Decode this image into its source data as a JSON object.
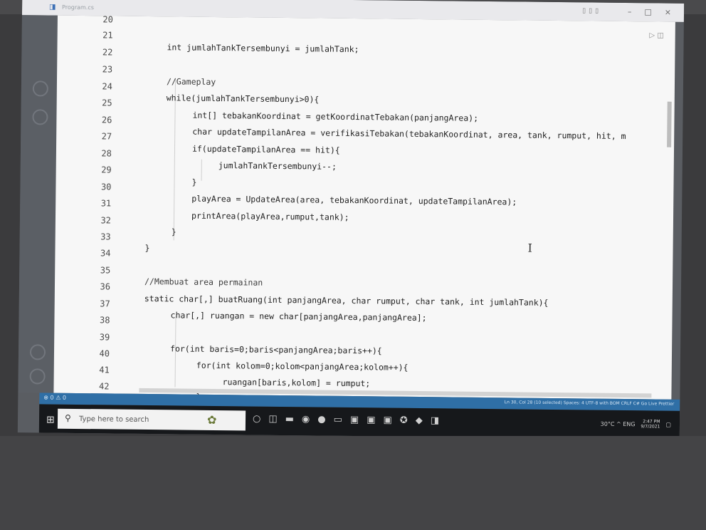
{
  "window": {
    "title": "Program.cs",
    "controls": [
      "–",
      "□",
      "×"
    ],
    "layout_icons": [
      "▯",
      "▯",
      "▯"
    ]
  },
  "editor": {
    "toolbar_icons": "▷ ◫",
    "lines": [
      {
        "n": "20",
        "code": ""
      },
      {
        "n": "21",
        "code": ""
      },
      {
        "n": "22",
        "code": "int jumlahTankTersembunyi = jumlahTank;"
      },
      {
        "n": "23",
        "code": ""
      },
      {
        "n": "24",
        "code": "//Gameplay"
      },
      {
        "n": "25",
        "code": "while(jumlahTankTersembunyi>0){"
      },
      {
        "n": "26",
        "code": "int[] tebakanKoordinat = getKoordinatTebakan(panjangArea);"
      },
      {
        "n": "27",
        "code": "char updateTampilanArea = verifikasiTebakan(tebakanKoordinat, area, tank, rumput, hit, m"
      },
      {
        "n": "28",
        "code": "if(updateTampilanArea == hit){"
      },
      {
        "n": "29",
        "code": "jumlahTankTersembunyi--;"
      },
      {
        "n": "30",
        "code": "}"
      },
      {
        "n": "31",
        "code": "playArea = UpdateArea(area, tebakanKoordinat, updateTampilanArea);"
      },
      {
        "n": "32",
        "code": "printArea(playArea,rumput,tank);"
      },
      {
        "n": "33",
        "code": "}"
      },
      {
        "n": "34",
        "code": "}"
      },
      {
        "n": "35",
        "code": ""
      },
      {
        "n": "36",
        "code": "//Membuat area permainan"
      },
      {
        "n": "37",
        "code": "static char[,] buatRuang(int panjangArea, char rumput, char tank, int jumlahTank){"
      },
      {
        "n": "38",
        "code": "char[,] ruangan = new char[panjangArea,panjangArea];"
      },
      {
        "n": "39",
        "code": ""
      },
      {
        "n": "40",
        "code": "for(int baris=0;baris<panjangArea;baris++){"
      },
      {
        "n": "41",
        "code": "for(int kolom=0;kolom<panjangArea;kolom++){"
      },
      {
        "n": "42",
        "code": "ruangan[baris,kolom] = rumput;"
      },
      {
        "n": "",
        "code": "}"
      }
    ]
  },
  "statusbar": {
    "left": "⊗ 0 ⚠ 0",
    "right": "Ln 30, Col 28 (10 selected)   Spaces: 4   UTF-8 with BOM   CRLF   C#   Go Live   Prettier"
  },
  "taskbar": {
    "search_placeholder": "Type here to search",
    "tray": "30°C ^ ENG",
    "time": "2:47 PM",
    "date": "9/7/2021"
  },
  "colors": {
    "editor_bg": "#f7f7f7",
    "statusbar": "#2f6fa6",
    "taskbar": "#16181b",
    "selection": "#c5d6ea"
  }
}
